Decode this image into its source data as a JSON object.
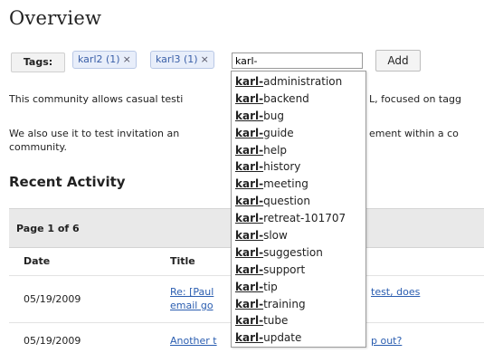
{
  "page": {
    "title": "Overview"
  },
  "tags": {
    "label": "Tags:",
    "items": [
      {
        "text": "karl2 (1)",
        "remove": "×"
      },
      {
        "text": "karl3 (1)",
        "remove": "×"
      }
    ],
    "input_value": "karl-",
    "add_label": "Add"
  },
  "description": {
    "line1_left": "This community allows casual testi",
    "line1_right": "L, focused on tagg",
    "line2_left": "We also use it to test invitation an",
    "line2_right": "ement within a co",
    "line3": "community."
  },
  "recent_activity": {
    "heading": "Recent Activity",
    "pager": "Page 1 of 6",
    "columns": [
      "Date",
      "Title"
    ],
    "rows": [
      {
        "date": "05/19/2009",
        "title_left_1": "Re: [Paul",
        "title_left_2": "email go",
        "title_right": "test, does"
      },
      {
        "date": "05/19/2009",
        "title_left_1": "Another t",
        "title_right": "p out?"
      }
    ]
  },
  "autocomplete": {
    "prefix": "karl-",
    "suggestions": [
      "administration",
      "backend",
      "bug",
      "guide",
      "help",
      "history",
      "meeting",
      "question",
      "retreat-101707",
      "slow",
      "suggestion",
      "support",
      "tip",
      "training",
      "tube",
      "update"
    ]
  }
}
